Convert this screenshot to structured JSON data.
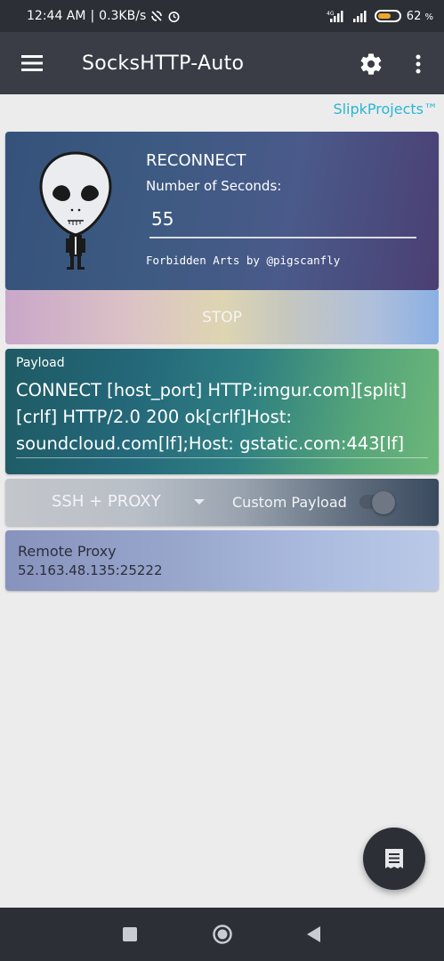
{
  "status_bar": {
    "time": "12:44 AM",
    "speed": "0.3KB/s",
    "network": "4G",
    "battery_percent": "62",
    "battery_suffix": "%",
    "battery_level": 0.62
  },
  "app_bar": {
    "title": "SocksHTTP-Auto"
  },
  "brand_link": "SlipkProjects™",
  "reconnect": {
    "title": "RECONNECT",
    "seconds_label": "Number of Seconds:",
    "seconds_value": "55",
    "credit": "Forbidden Arts by @pigscanfly",
    "stop_label": "STOP"
  },
  "payload": {
    "label": "Payload",
    "text": "CONNECT [host_port] HTTP:imgur.com][split][crlf] HTTP/2.0 200 ok[crlf]Host: soundcloud.com[lf];Host: gstatic.com:443[lf]"
  },
  "mode": {
    "selected": "SSH + PROXY",
    "custom_payload_label": "Custom Payload",
    "custom_payload_enabled": false
  },
  "remote_proxy": {
    "label": "Remote Proxy",
    "value": "52.163.48.135:25222"
  },
  "icons": {
    "menu": "hamburger-icon",
    "settings": "gear-icon",
    "more": "more-vert-icon",
    "fab": "log-icon",
    "nav": [
      "square-icon",
      "circle-icon",
      "back-triangle-icon"
    ]
  },
  "colors": {
    "accent": "#29b6d4",
    "app_bar": "#3a3d45",
    "status_bar": "#2c2f36",
    "battery": "#f0a52c"
  }
}
